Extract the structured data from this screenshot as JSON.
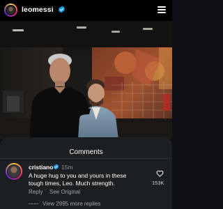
{
  "post": {
    "username": "leomessi"
  },
  "comments_sheet": {
    "title": "Comments",
    "comment": {
      "username": "cristiano",
      "time": "15m",
      "text": "A huge hug to you and yours in these tough times, Leo. Much strength.",
      "likes": "153K",
      "reply_label": "Reply",
      "see_original_label": "See Original"
    },
    "view_more_label": "View 2995 more replies"
  },
  "colors": {
    "accent_verified": "#1d9bf0",
    "sheet_background": "#1c1f22",
    "secondary_text": "#a0a5aa"
  }
}
